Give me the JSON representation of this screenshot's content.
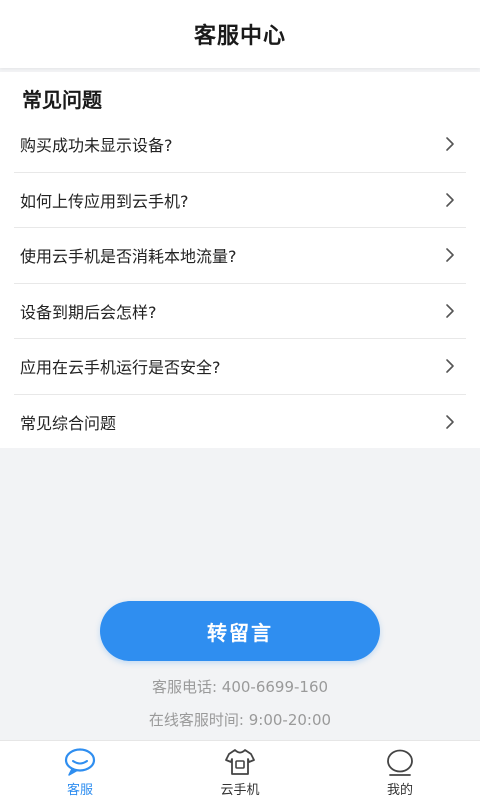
{
  "header": {
    "title": "客服中心"
  },
  "faq": {
    "title": "常见问题",
    "items": [
      {
        "label": "购买成功未显示设备?"
      },
      {
        "label": "如何上传应用到云手机?"
      },
      {
        "label": "使用云手机是否消耗本地流量?"
      },
      {
        "label": "设备到期后会怎样?"
      },
      {
        "label": "应用在云手机运行是否安全?"
      },
      {
        "label": "常见综合问题"
      }
    ]
  },
  "cta": {
    "label": "转留言"
  },
  "contact": {
    "phone": "客服电话:  400-6699-160",
    "hours": "在线客服时间:  9:00-20:00"
  },
  "tabbar": {
    "items": [
      {
        "label": "客服",
        "icon": "chat-bubble-icon",
        "active": true
      },
      {
        "label": "云手机",
        "icon": "tshirt-icon",
        "active": false
      },
      {
        "label": "我的",
        "icon": "user-circle-icon",
        "active": false
      }
    ]
  },
  "colors": {
    "accent": "#2f8ef0",
    "background": "#f2f3f5",
    "muted_text": "#9a9a9a"
  }
}
